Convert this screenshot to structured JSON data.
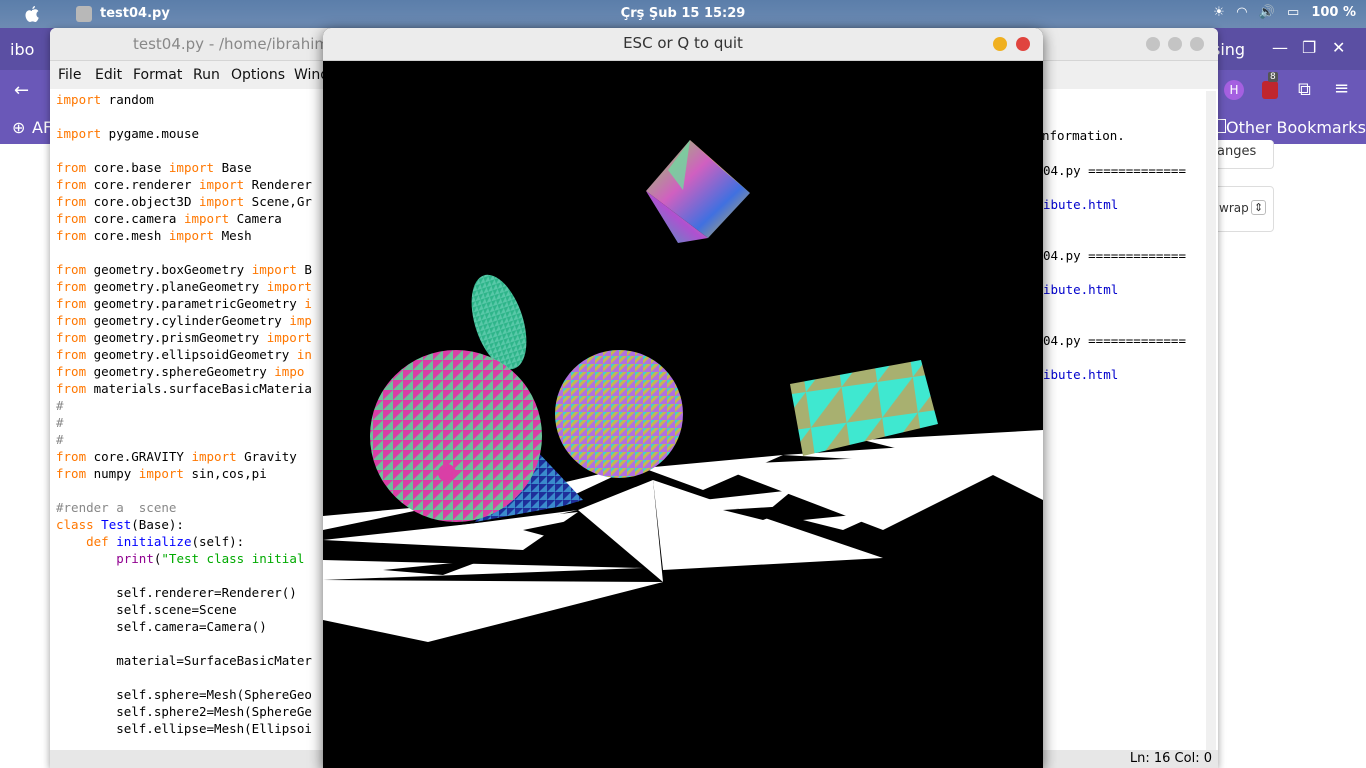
{
  "topbar": {
    "app_name": "test04.py",
    "clock": "Çrş Şub 15  15:29",
    "battery": "100 %"
  },
  "browser": {
    "tab_fragment_left": "ibo",
    "tab_fragment_right": "sing",
    "bookmark_left": "AF",
    "bookmark_right": "Other Bookmarks",
    "chip_changes": "anges",
    "chip_wrap": "wrap",
    "badge_count": "8"
  },
  "idle": {
    "title": "test04.py - /home/ibrahim/",
    "menu": [
      "File",
      "Edit",
      "Format",
      "Run",
      "Options",
      "Wind"
    ],
    "status": "Ln: 16  Col: 0",
    "shell": {
      "info": "nformation.",
      "run1": "04.py =============",
      "link1": "ibute.html",
      "run2": "04.py =============",
      "link2": "ibute.html",
      "run3": "04.py =============",
      "link3": "ibute.html"
    }
  },
  "pygame": {
    "title": "ESC or Q to quit",
    "colors": {
      "cube": "#7a5cd8",
      "sphere1": "#d93fa6",
      "sphere2": "#b0b050",
      "ellipse": "#2fb58a",
      "prism": "#2a48b8",
      "plane": "#3fe8d0",
      "floor": "#ffffff"
    }
  }
}
